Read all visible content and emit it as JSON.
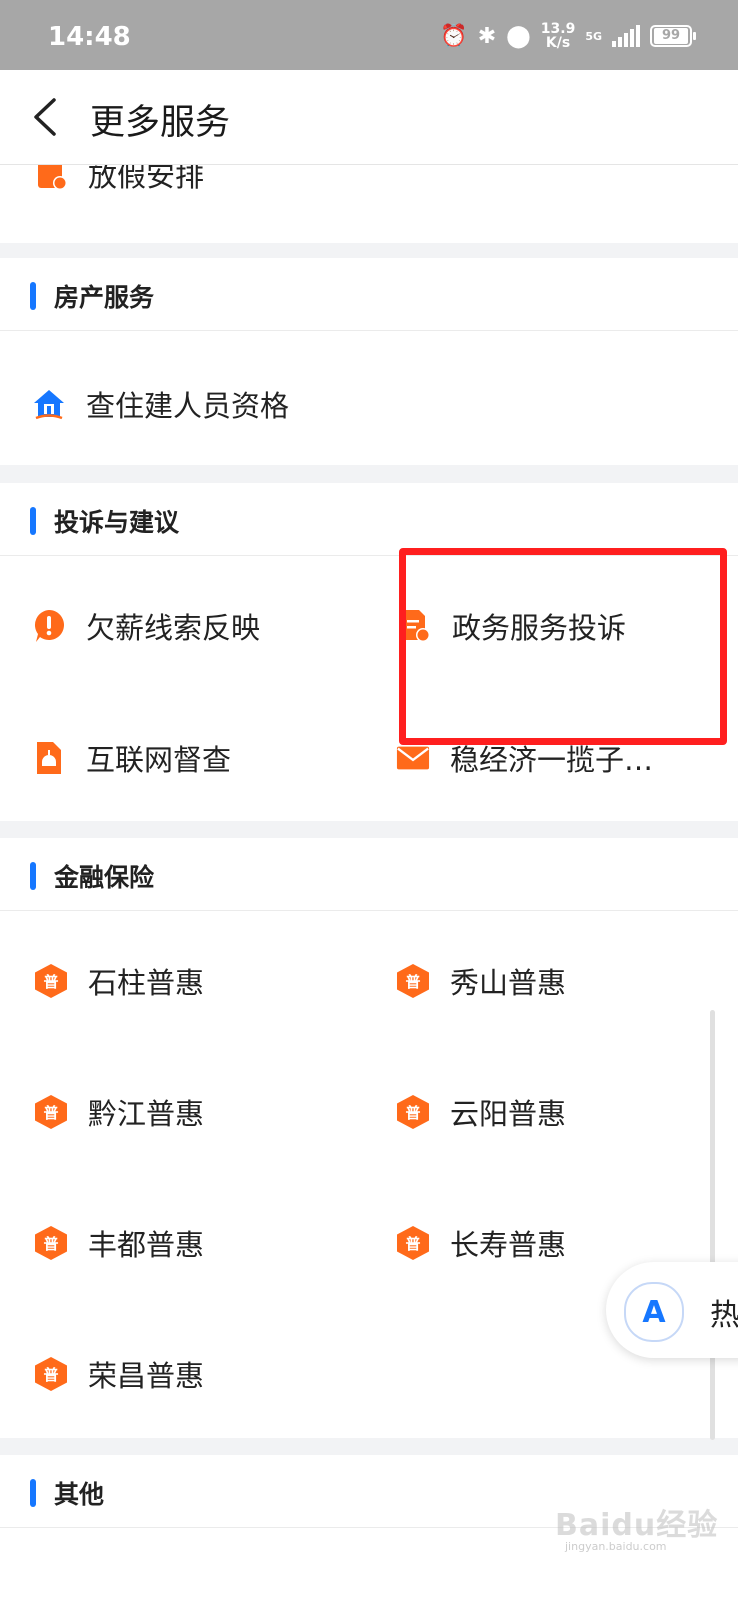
{
  "status_bar": {
    "time": "14:48",
    "speed_value": "13.9",
    "speed_unit": "K/s",
    "network": "5G",
    "battery": "99"
  },
  "nav": {
    "title": "更多服务"
  },
  "partial_item": {
    "label": "放假安排"
  },
  "sections": {
    "property": {
      "title": "房产服务",
      "items": [
        "查住建人员资格"
      ]
    },
    "complaints": {
      "title": "投诉与建议",
      "items": [
        "欠薪线索反映",
        "政务服务投诉",
        "互联网督查",
        "稳经济一揽子…"
      ]
    },
    "finance": {
      "title": "金融保险",
      "items": [
        "石柱普惠",
        "秀山普惠",
        "黔江普惠",
        "云阳普惠",
        "丰都普惠",
        "长寿普惠",
        "荣昌普惠"
      ],
      "icon_text": "普"
    },
    "other": {
      "title": "其他"
    }
  },
  "floating_button": {
    "icon": "A",
    "partial_text": "热"
  },
  "watermark": {
    "text": "Baidu经验",
    "sub": "jingyan.baidu.com"
  },
  "colors": {
    "accent": "#1677ff",
    "icon_orange": "#ff6a1a",
    "highlight": "#ff1f1f"
  }
}
